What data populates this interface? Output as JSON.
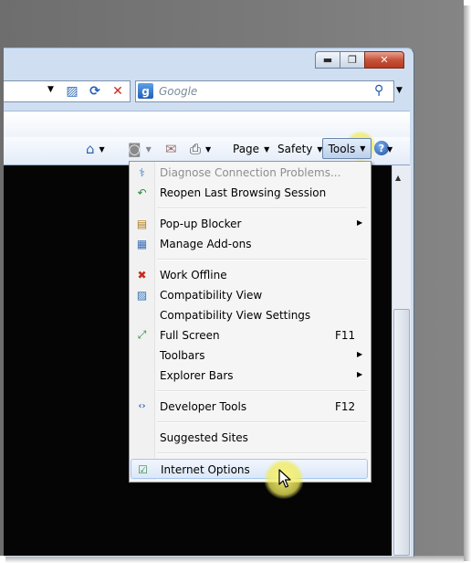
{
  "window": {
    "minimize_label": "▬",
    "maximize_label": "❐",
    "close_label": "✕"
  },
  "address_bar": {
    "dropdown_icon": "▼",
    "compat_icon": "▨",
    "refresh_icon": "⟳",
    "stop_icon": "✕"
  },
  "search": {
    "logo": "g",
    "placeholder": "Google",
    "go_icon": "⚲",
    "dropdown_icon": "▼"
  },
  "command_bar": {
    "home_icon": "⌂",
    "feeds_icon": "◙",
    "mail_icon": "✉",
    "print_icon": "⎙",
    "page_label": "Page",
    "safety_label": "Safety",
    "tools_label": "Tools",
    "help_label": "?",
    "caret": "▼"
  },
  "tools_menu": {
    "items": [
      {
        "label": "Diagnose Connection Problems...",
        "icon": "diagnose-icon",
        "glyph": "⚕",
        "disabled": true
      },
      {
        "label": "Reopen Last Browsing Session",
        "icon": "reopen-icon",
        "glyph": "↶"
      },
      {
        "label": "Pop-up Blocker",
        "icon": "popup-blocker-icon",
        "glyph": "▤",
        "submenu": true
      },
      {
        "label": "Manage Add-ons",
        "icon": "addons-icon",
        "glyph": "▦"
      },
      {
        "label": "Work Offline",
        "icon": "offline-icon",
        "glyph": "✖"
      },
      {
        "label": "Compatibility View",
        "icon": "compat-view-icon",
        "glyph": "▨"
      },
      {
        "label": "Compatibility View Settings"
      },
      {
        "label": "Full Screen",
        "shortcut": "F11",
        "icon": "fullscreen-icon",
        "glyph": "⤢"
      },
      {
        "label": "Toolbars",
        "submenu": true
      },
      {
        "label": "Explorer Bars",
        "submenu": true
      },
      {
        "label": "Developer Tools",
        "shortcut": "F12",
        "icon": "devtools-icon",
        "glyph": "‹›"
      },
      {
        "label": "Suggested Sites"
      },
      {
        "label": "Internet Options",
        "icon": "internet-options-icon",
        "glyph": "☑",
        "highlighted": true
      }
    ],
    "submenu_arrow": "▶"
  }
}
